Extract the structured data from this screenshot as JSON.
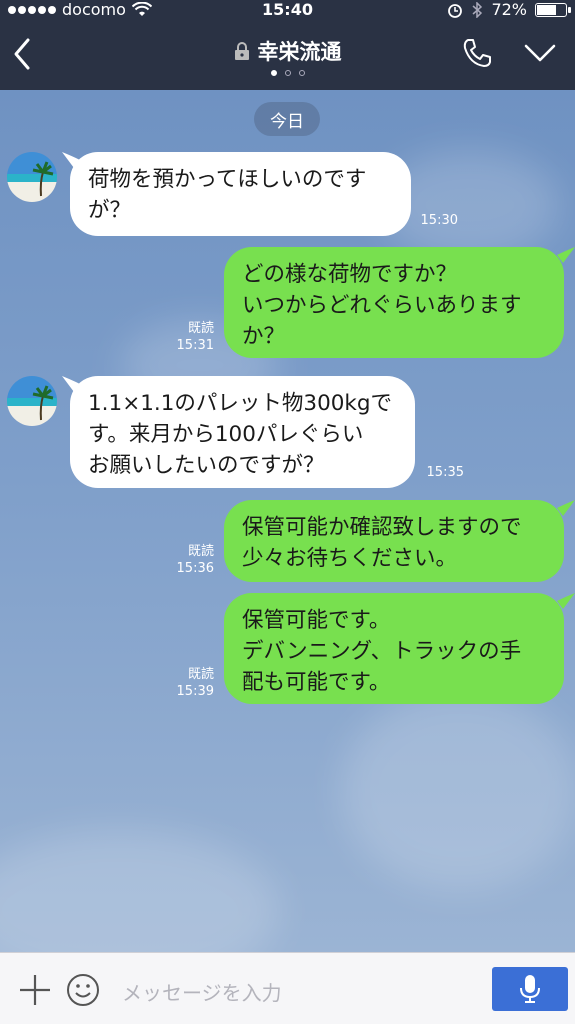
{
  "status": {
    "carrier": "docomo",
    "time": "15:40",
    "battery": "72%",
    "battery_level": 0.72
  },
  "header": {
    "title": "幸栄流通",
    "page_count": 3,
    "active_page": 0
  },
  "chat": {
    "date_label": "今日",
    "messages": [
      {
        "side": "in",
        "text": "荷物を預かってほしいのです\nが？",
        "time": "15:30",
        "read": ""
      },
      {
        "side": "out",
        "text": "どの様な荷物ですか？\nいつからどれぐらいあります\nか？",
        "time": "15:31",
        "read": "既読"
      },
      {
        "side": "in",
        "text": "1.1×1.1のパレット物300kgで\nす。来月から100パレぐらい\nお願いしたいのですが？",
        "time": "15:35",
        "read": ""
      },
      {
        "side": "out",
        "text": "保管可能か確認致しますので\n少々お待ちください。",
        "time": "15:36",
        "read": "既読"
      },
      {
        "side": "out",
        "text": "保管可能です。\nデバンニング、トラックの手\n配も可能です。",
        "time": "15:39",
        "read": "既読"
      }
    ]
  },
  "input": {
    "placeholder": "メッセージを入力"
  },
  "colors": {
    "header_bg": "#2a3244",
    "outgoing_bubble": "#78e04f",
    "incoming_bubble": "#ffffff",
    "mic_button": "#3b6fd6"
  }
}
